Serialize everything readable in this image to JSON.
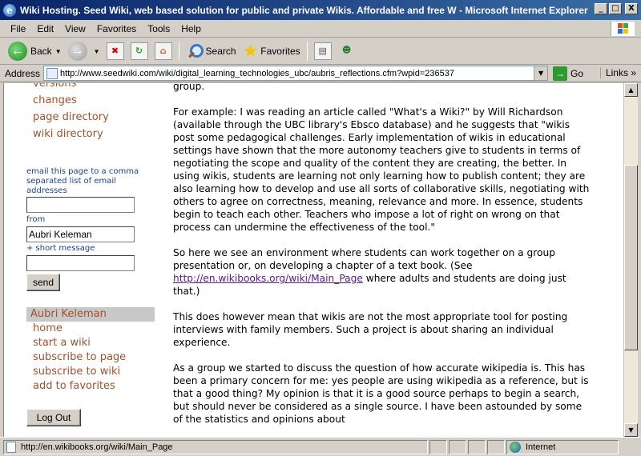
{
  "window": {
    "title": "Wiki Hosting. Seed Wiki, web based solution for public and private Wikis. Affordable and free W - Microsoft Internet Explorer",
    "minimize": "_",
    "maximize": "□",
    "close": "X"
  },
  "menu": [
    "File",
    "Edit",
    "View",
    "Favorites",
    "Tools",
    "Help"
  ],
  "toolbar": {
    "back": "Back",
    "search": "Search",
    "favorites": "Favorites"
  },
  "address": {
    "label": "Address",
    "url": "http://www.seedwiki.com/wiki/digital_learning_technologies_ubc/aubris_reflections.cfm?wpid=236537",
    "go": "Go",
    "links": "Links"
  },
  "sidebar": {
    "nav_partial": "versions",
    "nav": [
      "changes",
      "page directory",
      "wiki directory"
    ],
    "email_label": "email this page to a comma separated list of email addresses",
    "email_value": "",
    "from_label": "from",
    "from_value": "Aubri Keleman",
    "short_message_label": "+ short message",
    "message_value": "",
    "send": "send",
    "user": "Aubri Keleman",
    "user_links": [
      "home",
      "start a wiki",
      "subscribe to page",
      "subscribe to wiki",
      "add to favorites"
    ],
    "logout": "Log Out"
  },
  "content": {
    "p0": "group.",
    "p1": "For example: I was reading an article called \"What's a Wiki?\" by Will Richardson (available through the UBC library's Ebsco database) and he suggests that \"wikis post some pedagogical challenges. Early implementation of wikis in educational settings have shown that the more autonomy teachers give to students in terms of negotiating the scope and quality of the content they are creating, the better. In using wikis, students are learning not only learning how to publish content; they are also learning how to develop and use all sorts of collaborative skills, negotiating with others to agree on correctness, meaning, relevance and more. In essence, students begin to teach each other. Teachers who impose a lot of right on wrong on that process can undermine the effectiveness of the tool.\"",
    "p2_before": "So here we see an environment where students can work together on a group presentation or, on developing a chapter of a text book. (See ",
    "p2_link": "http://en.wikibooks.org/wiki/Main_Page",
    "p2_after": " where adults and students are doing just that.)",
    "p3": "This does however mean that wikis are not the most appropriate tool for posting interviews with family members. Such a project is about sharing an individual experience.",
    "p4": "As a group we started to discuss the question of how accurate wikipedia is. This has been a primary concern for me: yes people are using wikipedia as a reference, but is that a good thing? My opinion is that it is a good source perhaps to begin a search, but should never be considered as a single source. I have been astounded by some of the statistics and opinions about"
  },
  "status": {
    "text": "http://en.wikibooks.org/wiki/Main_Page",
    "zone": "Internet"
  },
  "colors": {
    "titlebar": "#0a246a",
    "link": "#a0522d",
    "visited_link": "#551a8b",
    "label_blue": "#1f3f8f"
  }
}
